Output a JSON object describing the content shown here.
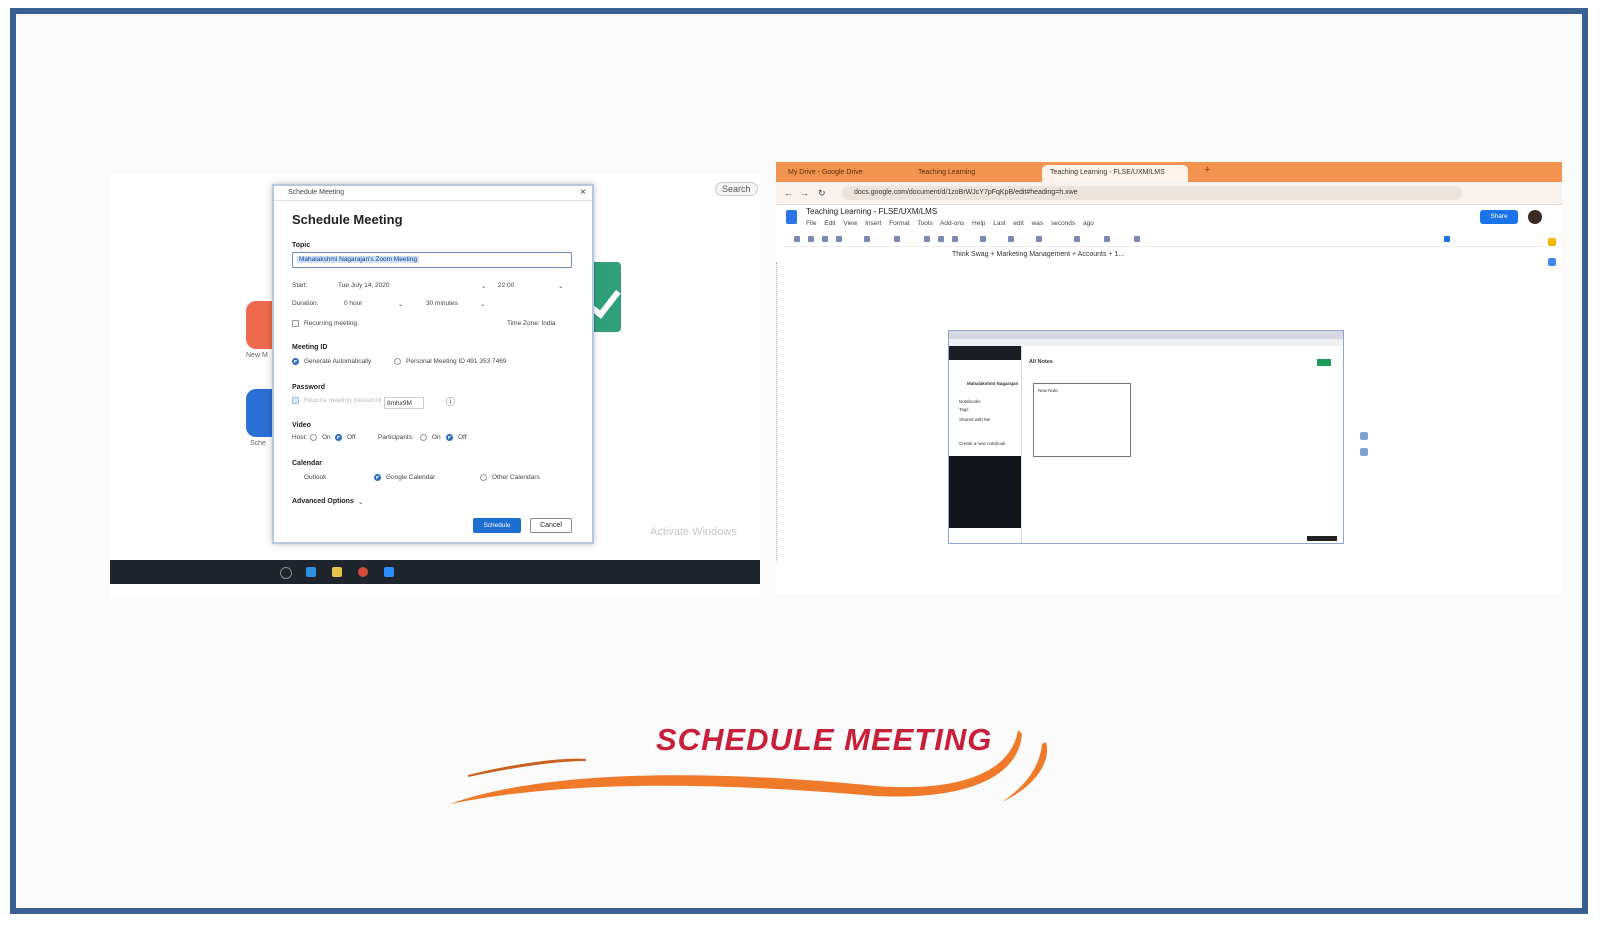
{
  "caption": "SCHEDULE MEETING",
  "colors": {
    "frame": "#3a5f93",
    "caption": "#c8203a",
    "swoosh": "#ee7a2a",
    "browser_tabs": "#f29350",
    "zoom_blue": "#1c6fd1"
  },
  "zoom_desktop": {
    "search_chip": "Search",
    "activate_windows": "Activate Windows",
    "icon_labels": [
      "New M",
      "Sche"
    ],
    "dialog": {
      "titlebar": "Schedule Meeting",
      "heading": "Schedule Meeting",
      "topic_label": "Topic",
      "topic_value": "Mahalakshmi Nagarajan's Zoom Meeting",
      "start_label": "Start:",
      "start_date": "Tue  July 14, 2020",
      "start_time": "22:00",
      "duration_label": "Duration:",
      "duration_hours": "0 hour",
      "duration_minutes": "30 minutes",
      "recurring_label": "Recurring meeting",
      "timezone_label": "Time Zone: India",
      "meeting_id_label": "Meeting ID",
      "meeting_id_auto": "Generate Automatically",
      "meeting_id_personal": "Personal Meeting ID 491 353 7469",
      "password_label": "Password",
      "password_require": "Require meeting password",
      "password_value": "8mhx9M",
      "video_label": "Video",
      "host_label": "Host:",
      "participants_label": "Participants:",
      "on_label": "On",
      "off_label": "Off",
      "calendar_label": "Calendar",
      "calendar_outlook": "Outlook",
      "calendar_google": "Google Calendar",
      "calendar_other": "Other Calendars",
      "advanced_label": "Advanced Options",
      "schedule_button": "Schedule",
      "cancel_button": "Cancel"
    },
    "taskbar_icons": [
      "search-icon",
      "edge-icon",
      "folder-icon",
      "chrome-icon",
      "zoom-icon"
    ]
  },
  "browser": {
    "tabs": [
      "My Drive - Google Drive",
      "Teaching Learning",
      "Teaching Learning - FLSE/UXM/LMS"
    ],
    "url": "docs.google.com/document/d/1zoBrWJcY7pFqKpB/edit#heading=h.xwe",
    "doc_title": "Teaching Learning - FLSE/UXM/LMS",
    "doc_menu": "File  Edit  View  Insert  Format  Tools  Add-ons  Help  Last edit was seconds ago",
    "share_label": "Share",
    "doc_first_line": "Think Swag + Marketing Management + Accounts + 1...",
    "inner_screenshot": {
      "user_name": "Mahalakshmi Nagarajan",
      "all_notes": "All Notes",
      "sidebar_items": [
        "Notebooks",
        "Tags",
        "Shared with Me",
        "Create a new notebook"
      ],
      "card_title": "New Note"
    }
  }
}
